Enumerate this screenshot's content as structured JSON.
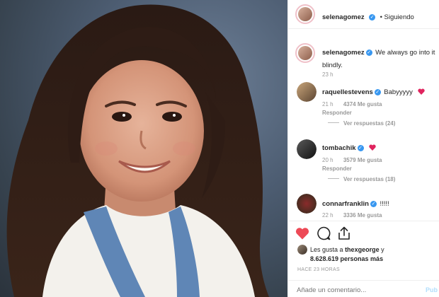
{
  "post": {
    "author": "selenagomez",
    "follow_status": "• Siguiendo",
    "caption": "We always go into it blindly.",
    "caption_time": "23 h"
  },
  "comments": [
    {
      "user": "raquellestevens",
      "text": "Babyyyyy",
      "time": "21 h",
      "likes": "4374 Me gusta",
      "reply": "Responder",
      "replies": "Ver respuestas (24)",
      "has_heart": true
    },
    {
      "user": "tombachik",
      "text": "",
      "time": "20 h",
      "likes": "3579 Me gusta",
      "reply": "Responder",
      "replies": "Ver respuestas (18)",
      "has_heart": true
    },
    {
      "user": "connarfranklin",
      "text": "!!!!!",
      "time": "22 h",
      "likes": "3336 Me gusta"
    }
  ],
  "actions": {
    "like_icon": "heart-filled-icon",
    "comment_icon": "comment-icon",
    "share_icon": "share-icon"
  },
  "likes": {
    "prefix": "Les gusta a",
    "user": "thexgeorge",
    "joiner": "y",
    "count": "8.628.619 personas más"
  },
  "timestamp": "HACE 23 HORAS",
  "comment_box": {
    "placeholder": "Añade un comentario...",
    "publish": "Pub"
  },
  "colors": {
    "accent": "#3897f0",
    "like_red": "#ed4956",
    "muted": "#999999"
  }
}
